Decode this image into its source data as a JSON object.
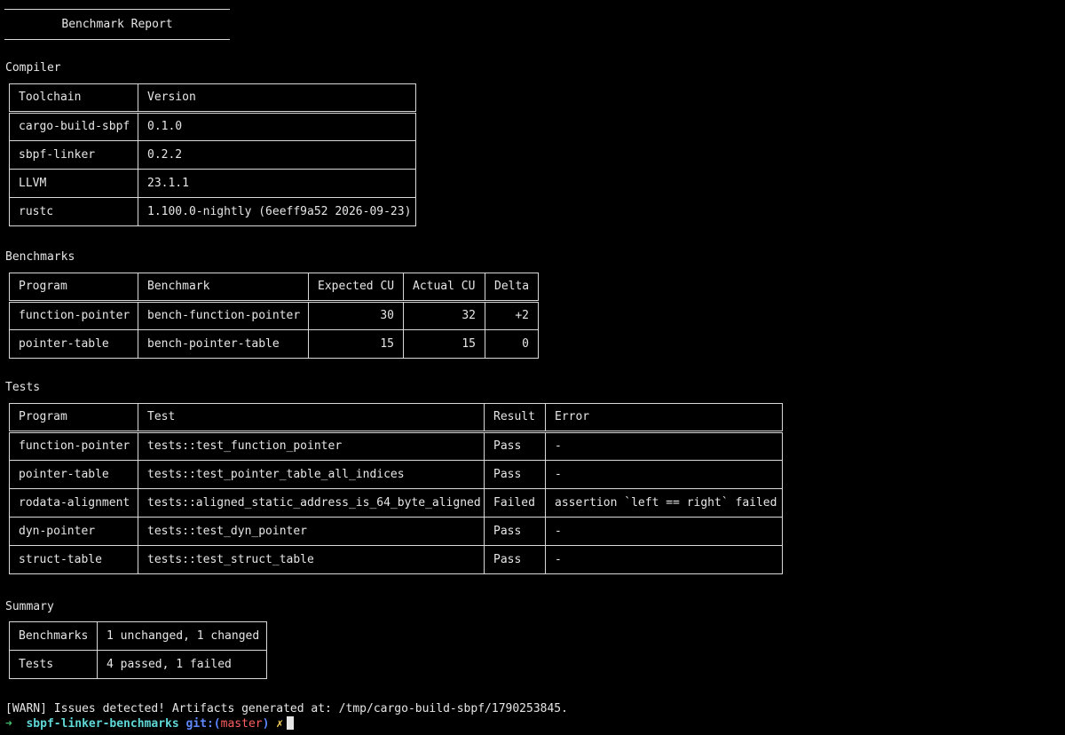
{
  "title": "Benchmark Report",
  "compiler": {
    "label": "Compiler",
    "headers": [
      "Toolchain",
      "Version"
    ],
    "rows": [
      [
        "cargo-build-sbpf",
        "0.1.0"
      ],
      [
        "sbpf-linker",
        "0.2.2"
      ],
      [
        "LLVM",
        "23.1.1"
      ],
      [
        "rustc",
        "1.100.0-nightly (6eeff9a52 2026-09-23)"
      ]
    ]
  },
  "benchmarks": {
    "label": "Benchmarks",
    "headers": [
      "Program",
      "Benchmark",
      "Expected CU",
      "Actual CU",
      "Delta"
    ],
    "rows": [
      [
        "function-pointer",
        "bench-function-pointer",
        "30",
        "32",
        "+2"
      ],
      [
        "pointer-table",
        "bench-pointer-table",
        "15",
        "15",
        "0"
      ]
    ]
  },
  "tests": {
    "label": "Tests",
    "headers": [
      "Program",
      "Test",
      "Result",
      "Error"
    ],
    "rows": [
      [
        "function-pointer",
        "tests::test_function_pointer",
        "Pass",
        "-"
      ],
      [
        "pointer-table",
        "tests::test_pointer_table_all_indices",
        "Pass",
        "-"
      ],
      [
        "rodata-alignment",
        "tests::aligned_static_address_is_64_byte_aligned",
        "Failed",
        "assertion `left == right` failed"
      ],
      [
        "dyn-pointer",
        "tests::test_dyn_pointer",
        "Pass",
        "-"
      ],
      [
        "struct-table",
        "tests::test_struct_table",
        "Pass",
        "-"
      ]
    ]
  },
  "summary": {
    "label": "Summary",
    "rows": [
      [
        "Benchmarks",
        "1 unchanged, 1 changed"
      ],
      [
        "Tests",
        "4 passed, 1 failed"
      ]
    ]
  },
  "warning": "[WARN] Issues detected! Artifacts generated at: /tmp/cargo-build-sbpf/1790253845.",
  "prompt": {
    "arrow": "➜",
    "directory": "sbpf-linker-benchmarks",
    "git_prefix": "git:(",
    "branch": "master",
    "git_suffix": ")",
    "dirty_marker": "✗"
  },
  "colors": {
    "background": "#000000",
    "text": "#e6e6e6",
    "prompt_arrow": "#3fbf6a",
    "prompt_dir": "#5fd7d7",
    "prompt_git": "#5f87ff",
    "prompt_branch": "#ff5f5f",
    "prompt_dirty": "#ffd75f"
  }
}
